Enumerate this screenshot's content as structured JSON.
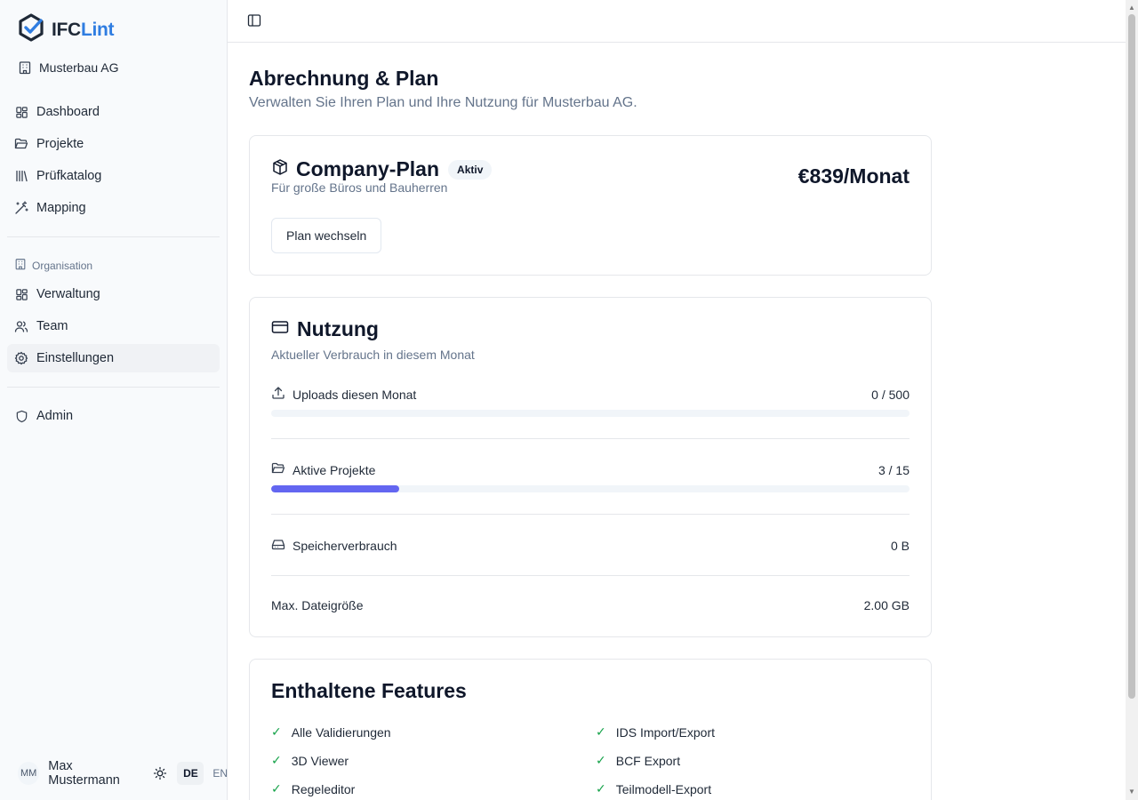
{
  "app": {
    "logo_ifc": "IFC",
    "logo_lint": "Lint"
  },
  "sidebar": {
    "org_name": "Musterbau AG",
    "items": [
      {
        "label": "Dashboard",
        "icon": "dashboard-icon"
      },
      {
        "label": "Projekte",
        "icon": "folder-icon"
      },
      {
        "label": "Prüfkatalog",
        "icon": "library-icon"
      },
      {
        "label": "Mapping",
        "icon": "wand-icon"
      }
    ],
    "section_label": "Organisation",
    "org_items": [
      {
        "label": "Verwaltung",
        "icon": "dashboard-icon"
      },
      {
        "label": "Team",
        "icon": "users-icon"
      },
      {
        "label": "Einstellungen",
        "icon": "gear-icon",
        "active": true
      }
    ],
    "admin_label": "Admin",
    "user": {
      "initials": "MM",
      "name": "Max Mustermann"
    },
    "lang_de": "DE",
    "lang_en": "EN"
  },
  "page": {
    "title": "Abrechnung & Plan",
    "subtitle": "Verwalten Sie Ihren Plan und Ihre Nutzung für Musterbau AG."
  },
  "plan": {
    "name": "Company-Plan",
    "badge": "Aktiv",
    "description": "Für große Büros und Bauherren",
    "price": "€839/Monat",
    "change_button": "Plan wechseln"
  },
  "usage": {
    "title": "Nutzung",
    "description": "Aktueller Verbrauch in diesem Monat",
    "uploads": {
      "label": "Uploads diesen Monat",
      "value": "0 / 500",
      "fraction": 0
    },
    "projects": {
      "label": "Aktive Projekte",
      "value": "3 / 15",
      "fraction": 0.2
    },
    "storage": {
      "label": "Speicherverbrauch",
      "value": "0 B"
    },
    "max_file": {
      "label": "Max. Dateigröße",
      "value": "2.00 GB"
    }
  },
  "features": {
    "title": "Enthaltene Features",
    "items": [
      "Alle Validierungen",
      "IDS Import/Export",
      "3D Viewer",
      "BCF Export",
      "Regeleditor",
      "Teilmodell-Export"
    ]
  },
  "colors": {
    "accent": "#6366f1",
    "brand_blue": "#2f7de1",
    "check_green": "#16a34a"
  }
}
